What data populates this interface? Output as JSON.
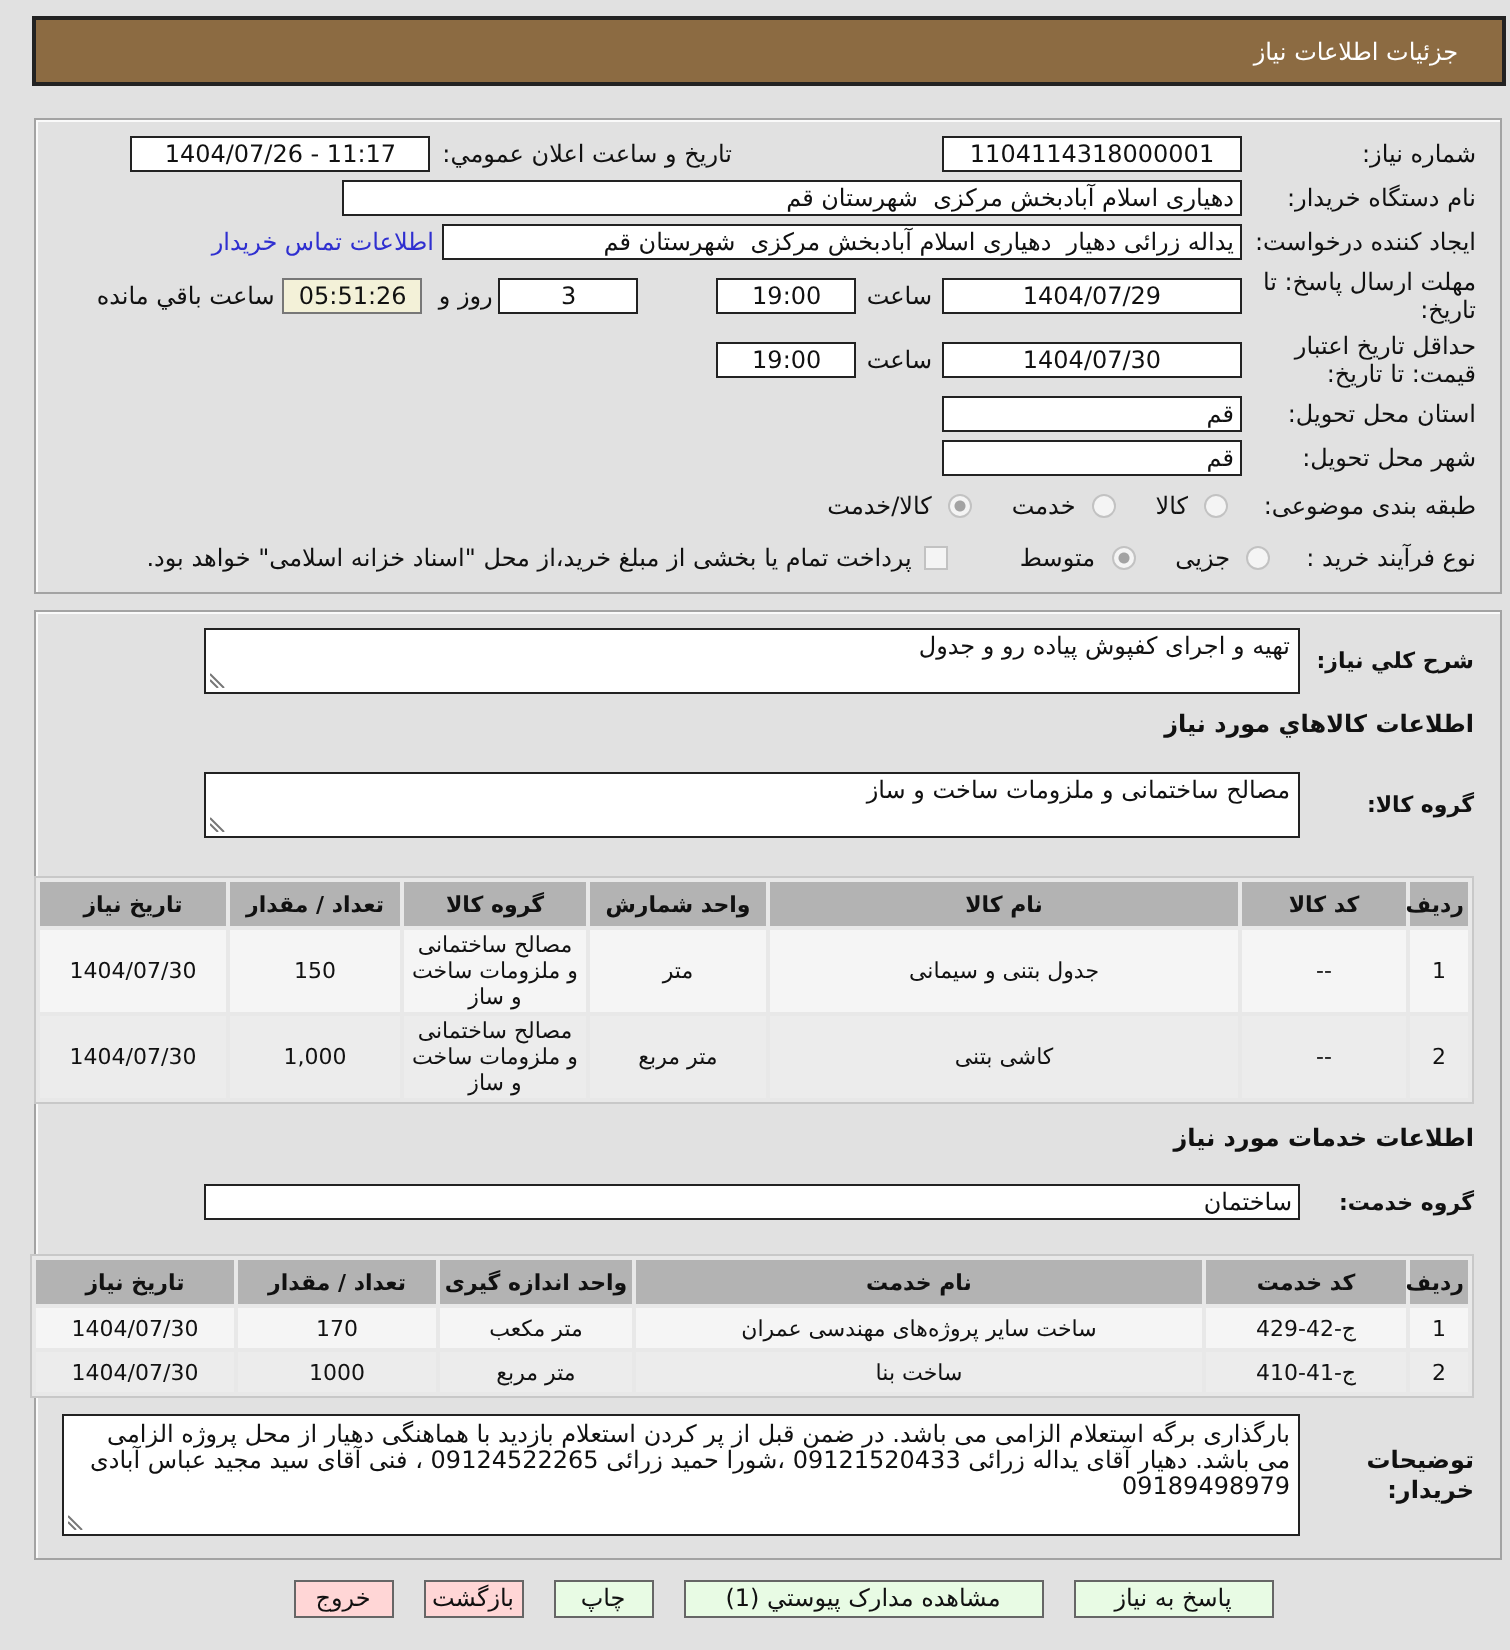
{
  "header": {
    "title": "جزئیات اطلاعات نیاز"
  },
  "details": {
    "need_number": {
      "label": "شماره نیاز:",
      "value": "1104114318000001"
    },
    "announcement": {
      "label": "تاریخ و ساعت اعلان عمومي:",
      "value": "1404/07/26 - 11:17"
    },
    "buyer_org": {
      "label": "نام دستگاه خریدار:",
      "value": "دهیاری اسلام آبادبخش مرکزی  شهرستان قم"
    },
    "requester": {
      "label": "ایجاد کننده درخواست:",
      "value": "یداله زرائی دهیار  دهیاری اسلام آبادبخش مرکزی  شهرستان قم",
      "link": "اطلاعات تماس خریدار"
    },
    "deadline": {
      "label": "مهلت ارسال پاسخ: تا تاریخ:",
      "date": "1404/07/29",
      "time_label": "ساعت",
      "time": "19:00",
      "days": "3",
      "days_label": "روز و",
      "remaining": "05:51:26",
      "remaining_label": "ساعت باقي مانده"
    },
    "price_validity": {
      "label": "حداقل تاریخ اعتبار قیمت: تا تاریخ:",
      "date": "1404/07/30",
      "time_label": "ساعت",
      "time": "19:00"
    },
    "province": {
      "label": "استان محل تحویل:",
      "value": "قم"
    },
    "city": {
      "label": "شهر محل تحویل:",
      "value": "قم"
    },
    "category": {
      "label": "طبقه بندی موضوعی:",
      "options": [
        {
          "label": "کالا",
          "selected": false
        },
        {
          "label": "خدمت",
          "selected": false
        },
        {
          "label": "کالا/خدمت",
          "selected": true
        }
      ]
    },
    "purchase_process": {
      "label": "نوع فرآیند خرید :",
      "options": [
        {
          "label": "جزیی",
          "selected": false
        },
        {
          "label": "متوسط",
          "selected": true
        }
      ],
      "treasury_payment": {
        "label": "پرداخت تمام یا بخشی از مبلغ خرید،از محل \"اسناد خزانه اسلامی\" خواهد بود.",
        "checked": false
      }
    }
  },
  "items": {
    "description": {
      "label": "شرح کلي نیاز:",
      "value": "تهیه و اجرای کفپوش پیاده رو و جدول"
    },
    "goods": {
      "heading": "اطلاعات کالاهاي مورد نیاز",
      "group_label": "گروه کالا:",
      "group_value": "مصالح ساختمانی و ملزومات ساخت و ساز",
      "table": {
        "columns": [
          "ردیف",
          "کد کالا",
          "نام کالا",
          "واحد شمارش",
          "گروه کالا",
          "تعداد / مقدار",
          "تاریخ نیاز"
        ],
        "rows": [
          [
            "1",
            "--",
            "جدول بتنی و سیمانی",
            "متر",
            "مصالح ساختمانی و ملزومات ساخت و ساز",
            "150",
            "1404/07/30"
          ],
          [
            "2",
            "--",
            "کاشی بتنی",
            "متر مربع",
            "مصالح ساختمانی و ملزومات ساخت و ساز",
            "1,000",
            "1404/07/30"
          ]
        ]
      }
    },
    "services": {
      "heading": "اطلاعات خدمات مورد نیاز",
      "group_label": "گروه خدمت:",
      "group_value": "ساختمان",
      "table": {
        "columns": [
          "ردیف",
          "کد خدمت",
          "نام خدمت",
          "واحد اندازه گیری",
          "تعداد / مقدار",
          "تاریخ نیاز"
        ],
        "rows": [
          [
            "1",
            "ج-42-429",
            "ساخت سایر پروژه‌های مهندسی عمران",
            "متر مکعب",
            "170",
            "1404/07/30"
          ],
          [
            "2",
            "ج-41-410",
            "ساخت بنا",
            "متر مربع",
            "1000",
            "1404/07/30"
          ]
        ]
      }
    },
    "buyer_notes": {
      "label": "توضیحات خریدار:",
      "value": "بارگذاری برگه استعلام الزامی می باشد. در ضمن قبل از پر کردن استعلام بازدید با هماهنگی دهیار از محل پروژه الزامی می باشد. دهیار آقای یداله زرائی 09121520433 ،شورا حمید زرائی 09124522265 ، فنی آقای سید مجید عباس آبادی 09189498979"
    }
  },
  "buttons": [
    {
      "label": "پاسخ به نیاز",
      "color": "#e8fbe4"
    },
    {
      "label": "مشاهده مدارک پیوستي (1)",
      "color": "#e8fbe4"
    },
    {
      "label": "چاپ",
      "color": "#e8fbe4"
    },
    {
      "label": "بازگشت",
      "color": "#ffd6d6"
    },
    {
      "label": "خروج",
      "color": "#ffd6d6"
    }
  ]
}
